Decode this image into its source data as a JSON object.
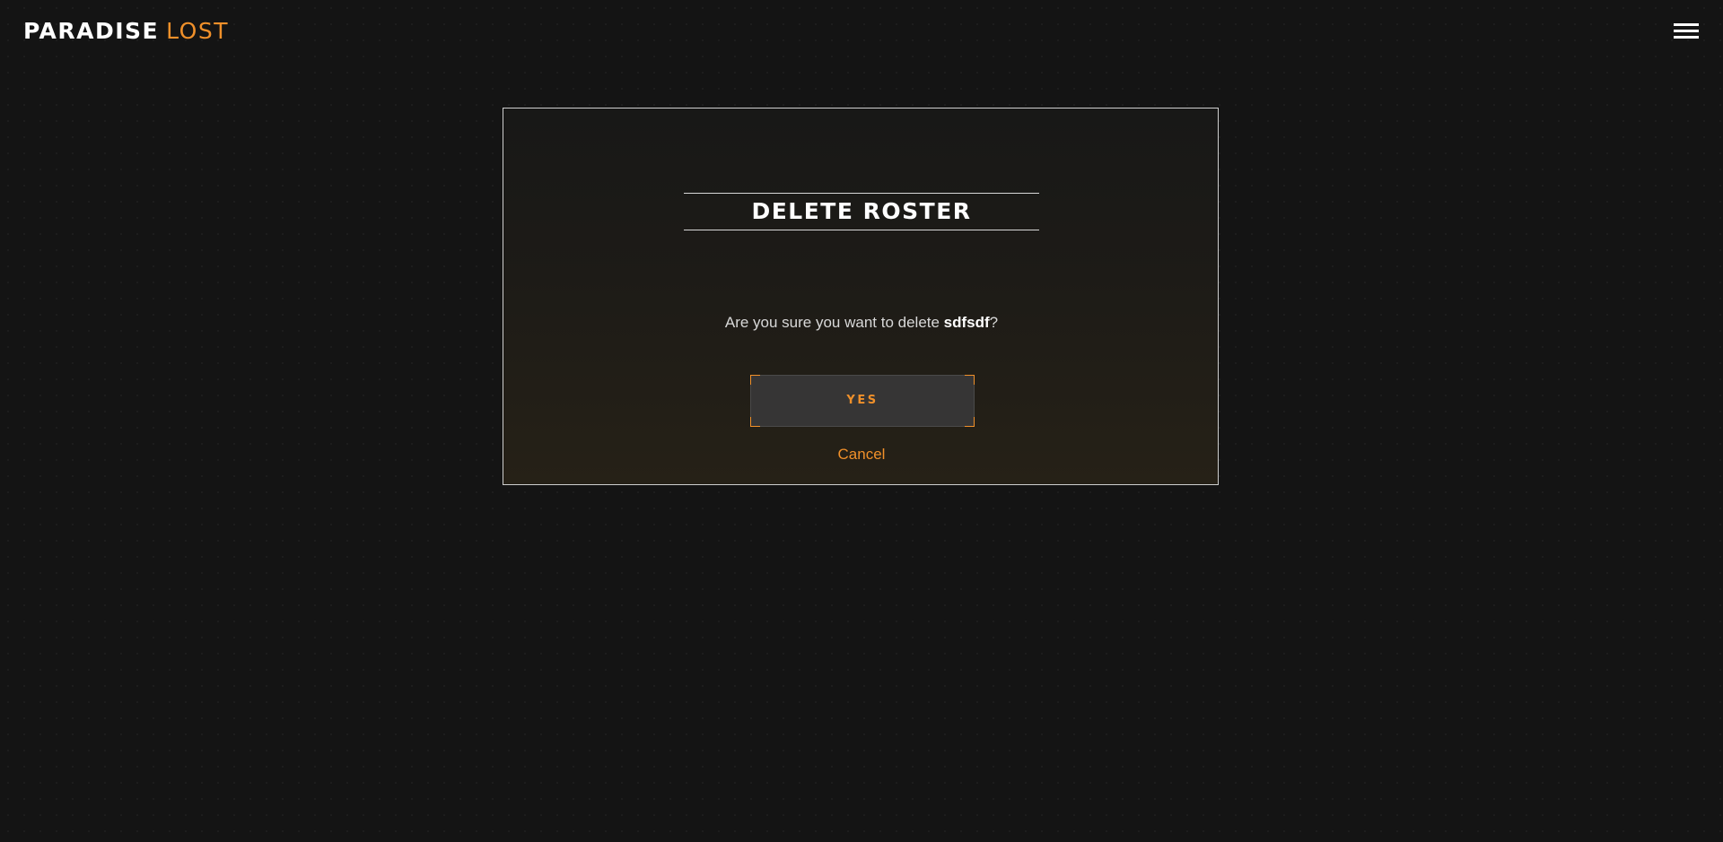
{
  "header": {
    "logo_word1": "PARADISE",
    "logo_word2": "LOST",
    "menu_icon": "hamburger-menu-icon"
  },
  "dialog": {
    "title": "DELETE ROSTER",
    "message_prefix": "Are you sure you want to delete ",
    "roster_name": "sdfsdf",
    "message_suffix": "?",
    "confirm_label": "YES",
    "cancel_label": "Cancel"
  },
  "colors": {
    "background": "#141414",
    "accent": "#f0902a",
    "text": "#e6e6e6",
    "button_bg": "#363535"
  }
}
